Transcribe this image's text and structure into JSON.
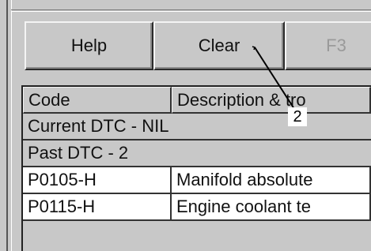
{
  "toolbar": {
    "buttons": [
      {
        "label": "Help",
        "enabled": true
      },
      {
        "label": "Clear",
        "enabled": true
      },
      {
        "label": "F3",
        "enabled": false
      }
    ]
  },
  "dtc_table": {
    "columns": [
      "Code",
      "Description & tro"
    ],
    "groups": [
      {
        "label": "Current DTC - NIL"
      },
      {
        "label": "Past DTC - 2"
      }
    ],
    "rows": [
      {
        "code": "P0105-H",
        "description": "Manifold absolute"
      },
      {
        "code": "P0115-H",
        "description": "Engine coolant te"
      }
    ]
  },
  "callout": {
    "number": "2"
  }
}
